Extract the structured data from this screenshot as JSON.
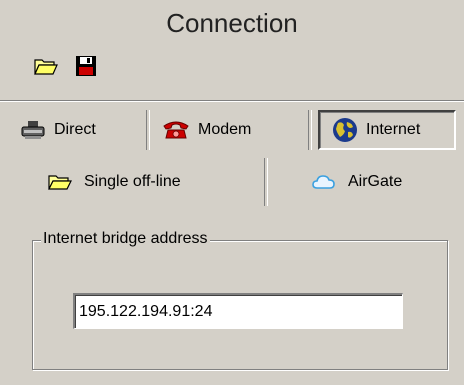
{
  "window": {
    "title": "Connection"
  },
  "toolbar": {
    "open_icon": "folder-open-icon",
    "save_icon": "floppy-disk-icon"
  },
  "tabs": [
    {
      "label": "Direct",
      "icon": "cable-connector-icon",
      "selected": false
    },
    {
      "label": "Modem",
      "icon": "telephone-icon",
      "selected": false
    },
    {
      "label": "Internet",
      "icon": "globe-icon",
      "selected": true
    }
  ],
  "subtabs": [
    {
      "label": "Single off-line",
      "icon": "folder-icon"
    },
    {
      "label": "AirGate",
      "icon": "cloud-icon"
    }
  ],
  "internet_bridge": {
    "group_label": "Internet bridge address",
    "address_value": "195.122.194.91:24"
  },
  "colors": {
    "background": "#d4d0c8",
    "folder_yellow": "#ffff99",
    "modem_red": "#cc0000",
    "globe_blue": "#1b3a8c",
    "cloud_blue": "#3aa0e0"
  }
}
